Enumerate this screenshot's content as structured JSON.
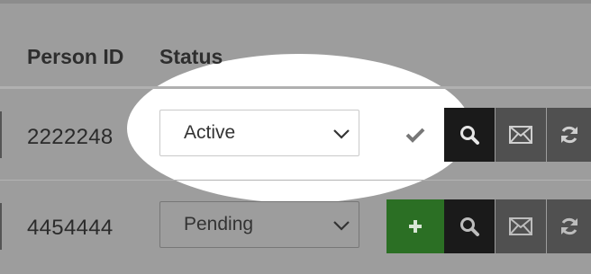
{
  "table": {
    "columns": {
      "person_id": "Person ID",
      "status": "Status"
    },
    "rows": [
      {
        "person_id": "2222248",
        "status": "Active",
        "actions": [
          "check-icon",
          "search-icon",
          "envelope-icon",
          "refresh-icon"
        ]
      },
      {
        "person_id": "4454444",
        "status": "Pending",
        "actions": [
          "plus-icon",
          "search-icon",
          "envelope-icon",
          "refresh-icon"
        ]
      }
    ]
  },
  "colors": {
    "highlight": "#ffffff",
    "add_button": "#2b6f24",
    "search_button": "#1a1a1a",
    "icon_buttons": "#505050"
  }
}
